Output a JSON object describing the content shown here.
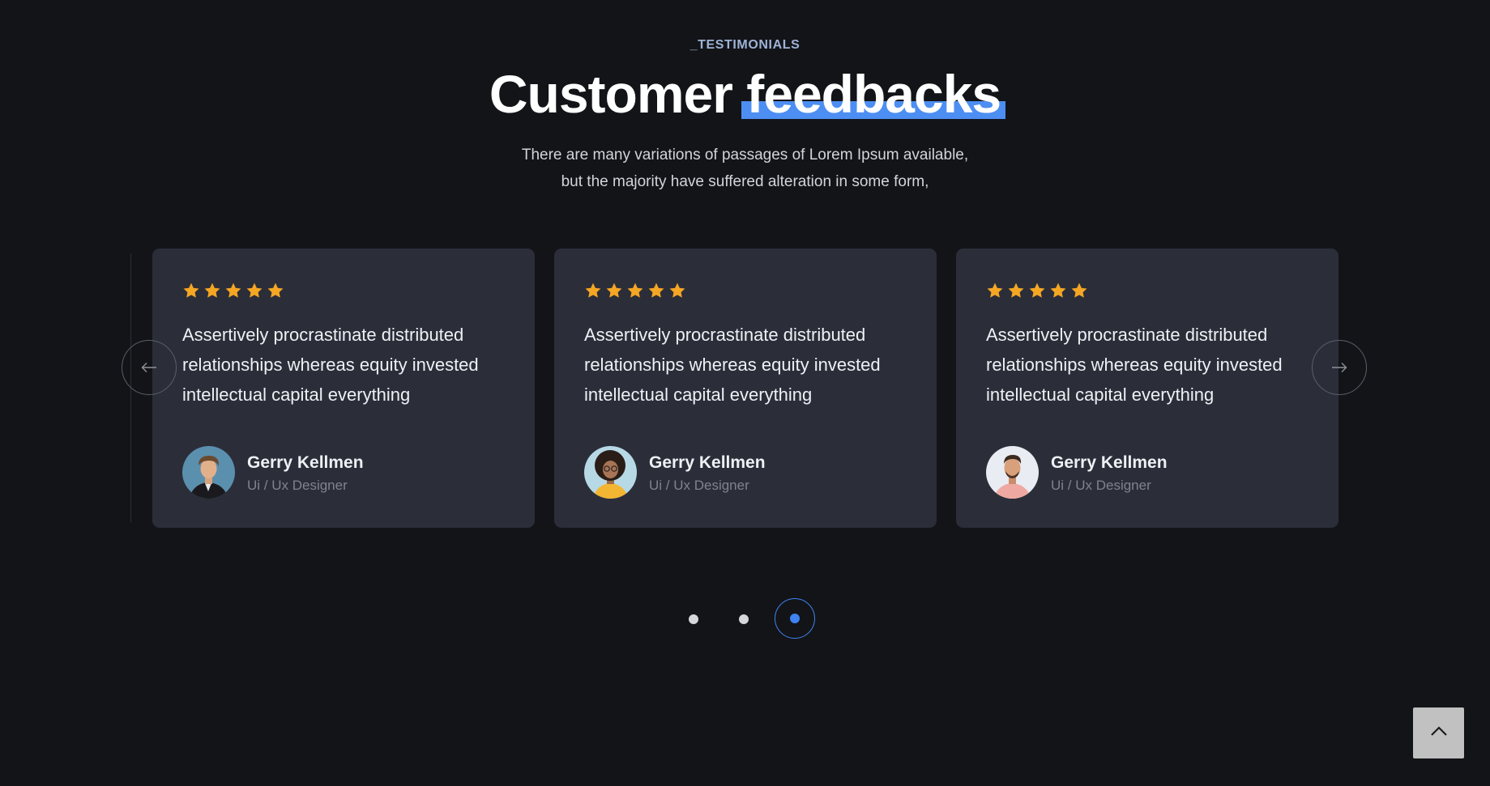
{
  "section": {
    "tag": "_TESTIMONIALS",
    "title_main": "Customer",
    "title_accent": "feedbacks",
    "subtitle_line1": "There are many variations of passages of Lorem Ipsum available,",
    "subtitle_line2": "but the majority have suffered alteration in some form,"
  },
  "colors": {
    "background": "#131418",
    "card": "#2b2e39",
    "accent_blue": "#4d8ef2",
    "star": "#f5a623"
  },
  "testimonials": [
    {
      "rating": 5,
      "quote": "Assertively procrastinate distributed relationships whereas equity invested intellectual capital everything",
      "name": "Gerry Kellmen",
      "role": "Ui / Ux Designer"
    },
    {
      "rating": 5,
      "quote": "Assertively procrastinate distributed relationships whereas equity invested intellectual capital everything",
      "name": "Gerry Kellmen",
      "role": "Ui / Ux Designer"
    },
    {
      "rating": 5,
      "quote": "Assertively procrastinate distributed relationships whereas equity invested intellectual capital everything",
      "name": "Gerry Kellmen",
      "role": "Ui / Ux Designer"
    }
  ],
  "carousel": {
    "prev_icon": "arrow-left-icon",
    "next_icon": "arrow-right-icon",
    "page_count": 3,
    "active_page": 3
  },
  "scroll_top": {
    "icon": "chevron-up-icon"
  }
}
